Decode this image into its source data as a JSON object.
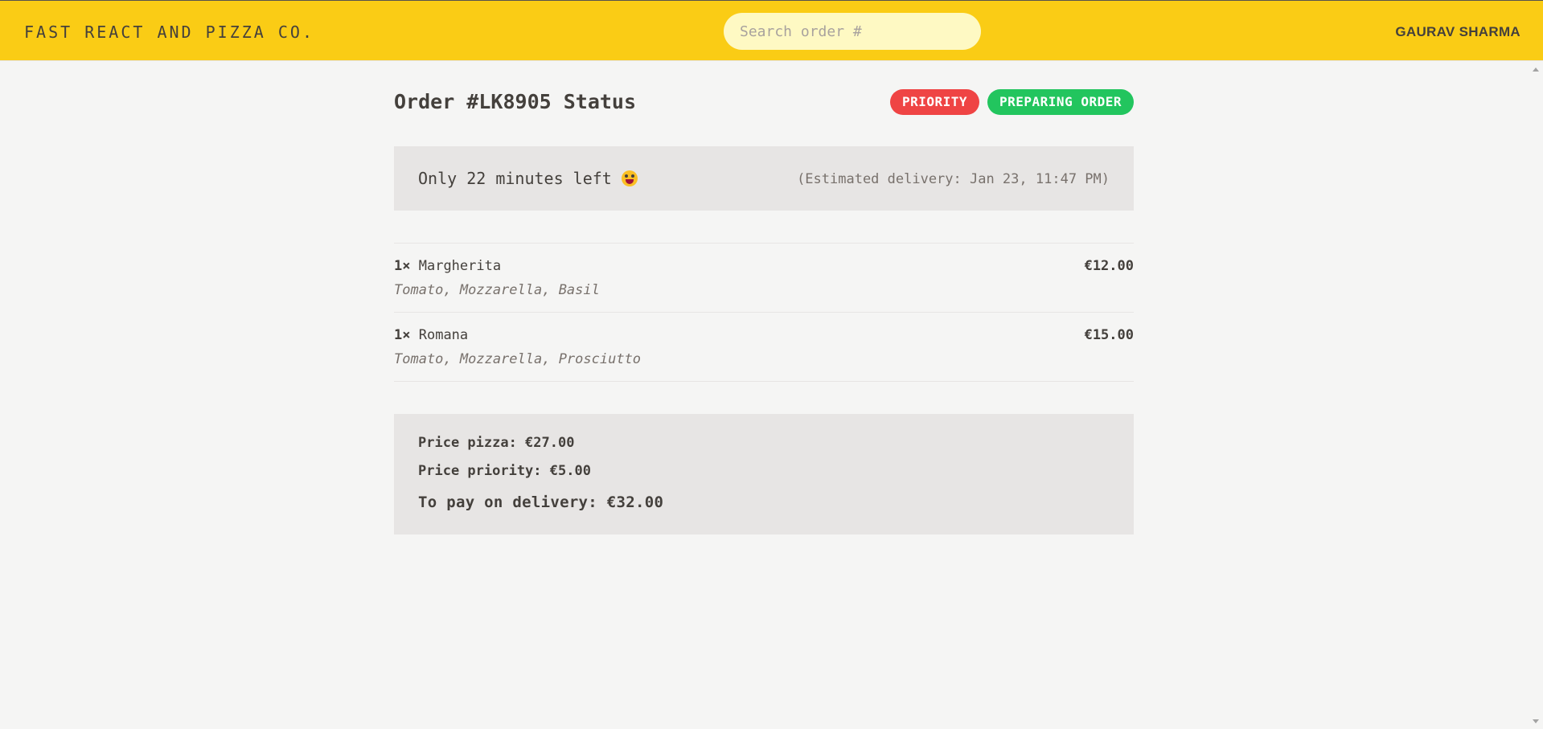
{
  "header": {
    "logo": "Fast React and Pizza Co.",
    "search_placeholder": "Search order #",
    "search_value": "",
    "username": "Gaurav Sharma"
  },
  "order": {
    "title": "Order #LK8905 Status",
    "badges": {
      "priority": "Priority",
      "status": "Preparing order"
    },
    "eta": {
      "remaining": "Only 22 minutes left",
      "emoji_icon": "grinning-face-emoji",
      "estimated": "(Estimated delivery: Jan 23, 11:47 PM)"
    },
    "items": [
      {
        "quantity": "1×",
        "name": "Margherita",
        "ingredients": "Tomato, Mozzarella, Basil",
        "price": "€12.00"
      },
      {
        "quantity": "1×",
        "name": "Romana",
        "ingredients": "Tomato, Mozzarella, Prosciutto",
        "price": "€15.00"
      }
    ],
    "summary": {
      "price_pizza": "Price pizza: €27.00",
      "price_priority": "Price priority: €5.00",
      "total": "To pay on delivery: €32.00"
    }
  },
  "colors": {
    "header_bg": "#facc15",
    "priority_badge": "#ef4444",
    "status_badge": "#22c55e",
    "page_bg": "#f5f5f4",
    "panel_bg": "#e7e5e4"
  }
}
